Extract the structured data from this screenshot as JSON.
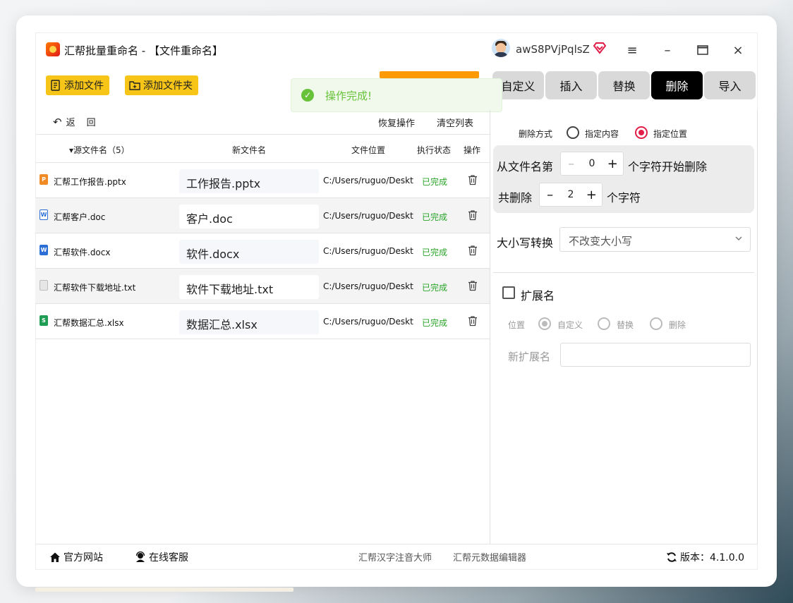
{
  "app": {
    "title": "汇帮批量重命名 - 【文件重命名】",
    "username": "awS8PVjPqlsZ"
  },
  "toolbar": {
    "add_file": "添加文件",
    "add_folder": "添加文件夹"
  },
  "tabs": [
    {
      "label": "自定义",
      "active": false
    },
    {
      "label": "插入",
      "active": false
    },
    {
      "label": "替换",
      "active": false
    },
    {
      "label": "删除",
      "active": true
    },
    {
      "label": "导入",
      "active": false
    }
  ],
  "toast": {
    "message": "操作完成!"
  },
  "list_actions": {
    "back": "返",
    "back2": "回",
    "restore": "恢复操作",
    "clear": "清空列表"
  },
  "table": {
    "headers": {
      "source": "源文件名（5）",
      "new_name": "新文件名",
      "location": "文件位置",
      "status": "执行状态",
      "action": "操作"
    },
    "rows": [
      {
        "source": "汇帮工作报告.pptx",
        "new_name": "工作报告.pptx",
        "location": "C:/Users/ruguo/Desktop",
        "status": "已完成",
        "icon": "pptx-icon"
      },
      {
        "source": "汇帮客户.doc",
        "new_name": "客户.doc",
        "location": "C:/Users/ruguo/Desktop",
        "status": "已完成",
        "icon": "doc-icon"
      },
      {
        "source": "汇帮软件.docx",
        "new_name": "软件.docx",
        "location": "C:/Users/ruguo/Desktop",
        "status": "已完成",
        "icon": "docx-icon"
      },
      {
        "source": "汇帮软件下载地址.txt",
        "new_name": "软件下载地址.txt",
        "location": "C:/Users/ruguo/Desktop",
        "status": "已完成",
        "icon": "txt-icon"
      },
      {
        "source": "汇帮数据汇总.xlsx",
        "new_name": "数据汇总.xlsx",
        "location": "C:/Users/ruguo/Desktop",
        "status": "已完成",
        "icon": "xlsx-icon"
      }
    ]
  },
  "delete_panel": {
    "mode_label": "删除方式",
    "option_content": "指定内容",
    "option_position": "指定位置",
    "from_label": "从文件名第",
    "from_value": "0",
    "from_suffix": "个字符开始删除",
    "count_label": "共删除",
    "count_value": "2",
    "count_suffix": "个字符",
    "case_label": "大小写转换",
    "case_value": "不改变大小写"
  },
  "extension": {
    "label": "扩展名",
    "position_label": "位置",
    "opt_custom": "自定义",
    "opt_replace": "替换",
    "opt_delete": "删除",
    "new_ext_label": "新扩展名"
  },
  "footer": {
    "website": "官方网站",
    "support": "在线客服",
    "link1": "汇帮汉字注音大师",
    "link2": "汇帮元数据编辑器",
    "version": "版本：4.1.0.0"
  },
  "colors": {
    "accent": "#f7c517",
    "selected_radio": "#e11d48",
    "success": "#67c23a",
    "status_green": "#2aa52a"
  }
}
